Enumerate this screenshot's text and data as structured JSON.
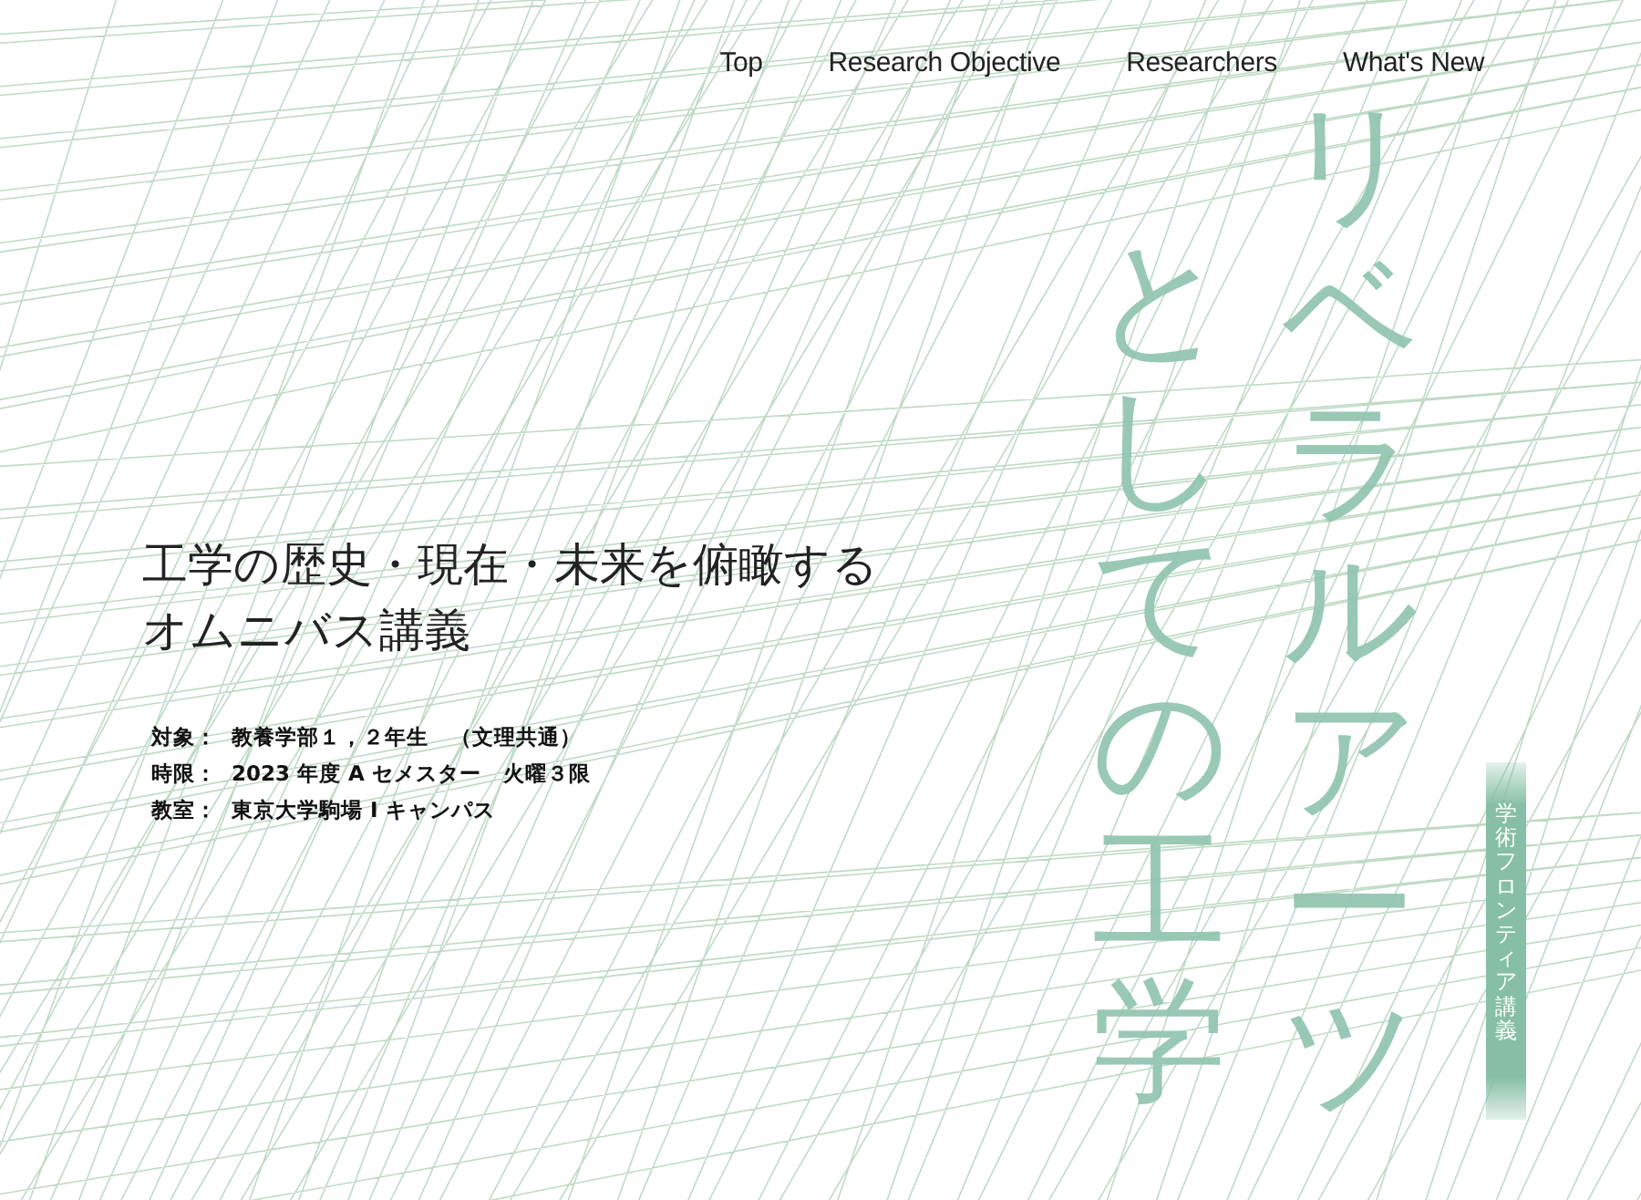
{
  "nav": [
    {
      "label": "Top"
    },
    {
      "label": "Research Objective"
    },
    {
      "label": "Researchers"
    },
    {
      "label": "What's New"
    }
  ],
  "heading": [
    "工学の歴史・現在・未来を俯瞰する",
    "オムニバス講義"
  ],
  "details": [
    {
      "label": "対象：",
      "value": "教養学部１，２年生　（文理共通）"
    },
    {
      "label": "時限：",
      "value": "2023 年度 A セメスター　火曜３限"
    },
    {
      "label": "教室：",
      "value": "東京大学駒場 I キャンパス"
    }
  ],
  "title_columns": [
    "としての工学",
    "リベラルアーツ"
  ],
  "series_label": "学術フロンティア講義"
}
